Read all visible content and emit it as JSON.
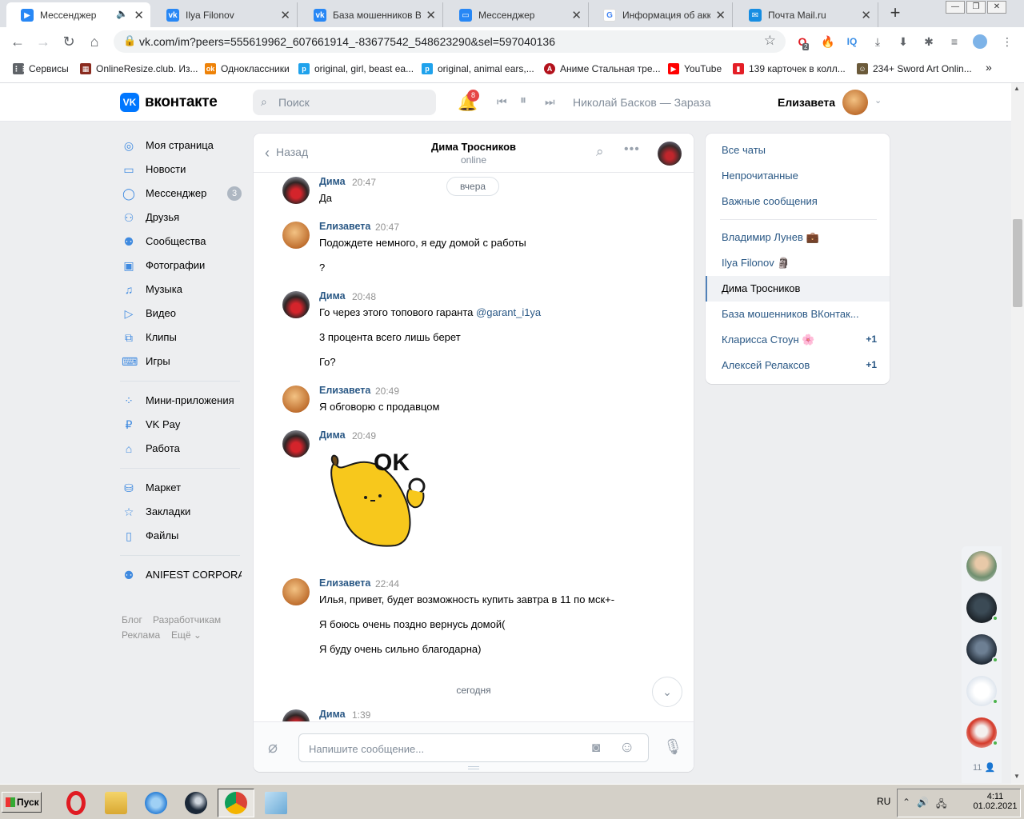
{
  "browser": {
    "tabs": [
      {
        "title": "Мессенджер",
        "icon": "vk-messenger-icon",
        "color": "#2787f5",
        "active": true
      },
      {
        "title": "Ilya Filonov",
        "icon": "vk-icon",
        "color": "#2787f5"
      },
      {
        "title": "База мошенников ВКон",
        "icon": "vk-icon",
        "color": "#2787f5"
      },
      {
        "title": "Мессенджер",
        "icon": "vk-messenger-icon",
        "color": "#2787f5"
      },
      {
        "title": "Информация об аккаун",
        "icon": "google-icon",
        "color": "#4285f4"
      },
      {
        "title": "Почта Mail.ru",
        "icon": "mail-icon",
        "color": "#168de2"
      }
    ],
    "url": "vk.com/im?peers=555619962_607661914_-83677542_548623290&sel=597040136",
    "opera_badge": "2",
    "bookmarks": [
      {
        "label": "Сервисы",
        "icon": "apps-grid-icon",
        "color": "#5f6368"
      },
      {
        "label": "OnlineResize.club. Из...",
        "icon": "onlineresize-icon",
        "color": "#8a2b1f"
      },
      {
        "label": "Одноклассники",
        "icon": "ok-icon",
        "color": "#ee8208"
      },
      {
        "label": "original, girl, beast ea...",
        "icon": "pinterest-p-icon",
        "color": "#1fa2ec"
      },
      {
        "label": "original, animal ears,...",
        "icon": "pinterest-p-icon",
        "color": "#1fa2ec"
      },
      {
        "label": "Аниме Стальная тре...",
        "icon": "anime-icon",
        "color": "#b3121c"
      },
      {
        "label": "YouTube",
        "icon": "youtube-icon",
        "color": "#ff0000"
      },
      {
        "label": "139 карточек в колл...",
        "icon": "bookmark-red-icon",
        "color": "#e41e26"
      },
      {
        "label": "234+ Sword Art Onlin...",
        "icon": "sao-icon",
        "color": "#6b5a3a"
      }
    ]
  },
  "vk": {
    "logo_text": "вконтакте",
    "search_placeholder": "Поиск",
    "notifications_count": "8",
    "now_playing": "Николай Басков — Зараза",
    "user_name": "Елизавета",
    "menu": [
      {
        "label": "Моя страница",
        "icon": "user-circle-icon"
      },
      {
        "label": "Новости",
        "icon": "news-icon"
      },
      {
        "label": "Мессенджер",
        "icon": "message-icon",
        "count": "3"
      },
      {
        "label": "Друзья",
        "icon": "friends-icon"
      },
      {
        "label": "Сообщества",
        "icon": "communities-icon"
      },
      {
        "label": "Фотографии",
        "icon": "photo-icon"
      },
      {
        "label": "Музыка",
        "icon": "music-icon"
      },
      {
        "label": "Видео",
        "icon": "video-icon"
      },
      {
        "label": "Клипы",
        "icon": "clips-icon"
      },
      {
        "label": "Игры",
        "icon": "gamepad-icon"
      },
      {
        "label": "Мини-приложения",
        "icon": "apps-icon"
      },
      {
        "label": "VK Pay",
        "icon": "vkpay-icon"
      },
      {
        "label": "Работа",
        "icon": "briefcase-icon"
      },
      {
        "label": "Маркет",
        "icon": "market-bag-icon"
      },
      {
        "label": "Закладки",
        "icon": "star-icon"
      },
      {
        "label": "Файлы",
        "icon": "file-icon"
      },
      {
        "label": "ANIFEST CORPORA...",
        "icon": "community-icon"
      }
    ],
    "footer": {
      "blog": "Блог",
      "developers": "Разработчикам",
      "ads": "Реклама",
      "more": "Ещё"
    }
  },
  "chat": {
    "back_label": "Назад",
    "peer_name": "Дима Тросников",
    "peer_status": "online",
    "date_pill": "вчера",
    "today_label": "сегодня",
    "messages": [
      {
        "author": "Дима",
        "time": "20:47",
        "lines": [
          "Да"
        ]
      },
      {
        "author": "Елизавета",
        "time": "20:47",
        "lines": [
          "Подождете немного, я еду домой с работы",
          "?"
        ]
      },
      {
        "author": "Дима",
        "time": "20:48",
        "lines": [
          "Го через этого топового гаранта",
          "3 процента всего лишь берет",
          "Го?"
        ],
        "mention": "@garant_i1ya"
      },
      {
        "author": "Елизавета",
        "time": "20:49",
        "lines": [
          "Я обговорю с продавцом"
        ]
      },
      {
        "author": "Дима",
        "time": "20:49",
        "lines": [],
        "sticker_text": "OK"
      },
      {
        "author": "Елизавета",
        "time": "22:44",
        "lines": [
          "Илья, привет, будет возможность купить завтра в 11 по мск+-",
          "Я боюсь очень поздно вернусь домой(",
          "Я буду очень сильно благодарна)"
        ]
      },
      {
        "author": "Дима",
        "time": "1:39",
        "lines": []
      }
    ],
    "composer_placeholder": "Напишите сообщение..."
  },
  "chatlist": {
    "filters": [
      "Все чаты",
      "Непрочитанные",
      "Важные сообщения"
    ],
    "items": [
      {
        "label": "Владимир Лунев 💼"
      },
      {
        "label": "Ilya Filonov 🗿"
      },
      {
        "label": "Дима Тросников",
        "active": true
      },
      {
        "label": "База мошенников ВКонтак..."
      },
      {
        "label": "Кларисса Стоун 🌸",
        "unread": "+1"
      },
      {
        "label": "Алексей Релаксов",
        "unread": "+1"
      }
    ]
  },
  "friends_online_count": "11",
  "taskbar": {
    "start_label": "Пуск",
    "lang": "RU",
    "time": "4:11",
    "date": "01.02.2021"
  }
}
